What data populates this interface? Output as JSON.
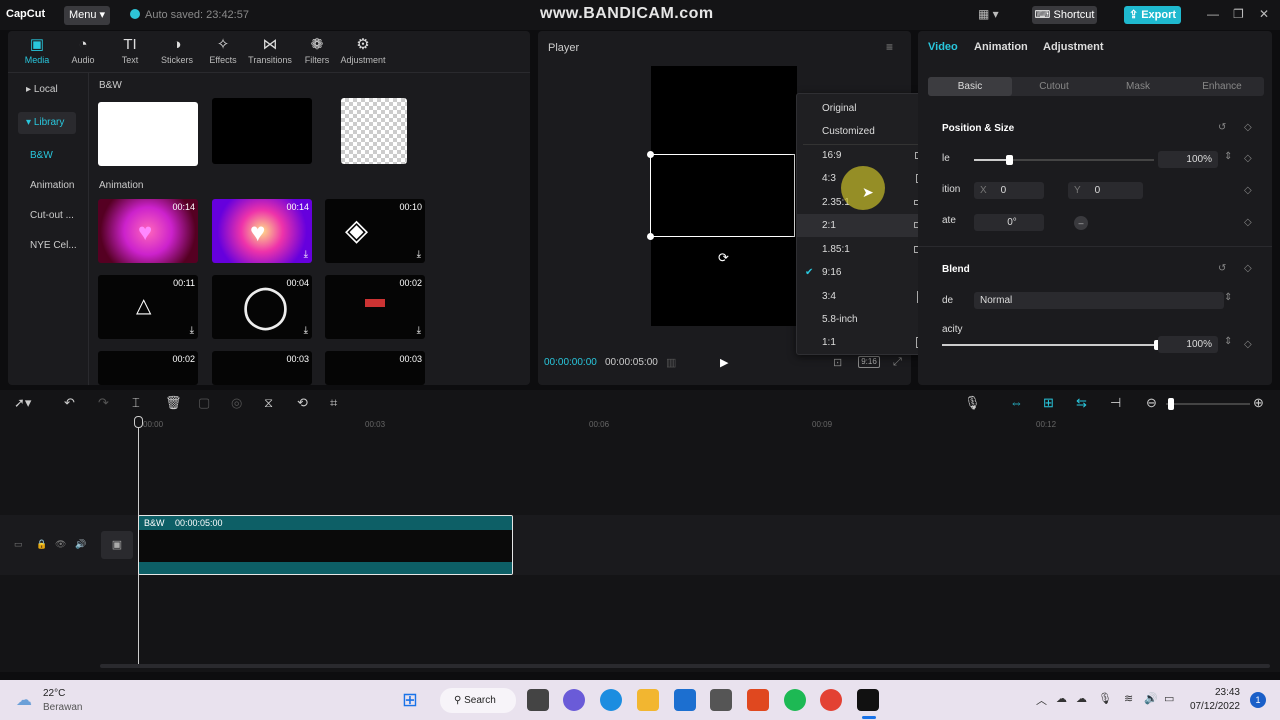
{
  "titlebar": {
    "app_name": "CapCut",
    "menu_label": "Menu",
    "autosave_text": "Auto saved: 23:42:57",
    "watermark": "www.BANDICAM.com",
    "shortcut_label": "Shortcut",
    "export_label": "Export"
  },
  "media": {
    "tools": [
      {
        "label": "Media",
        "icon": "media-icon"
      },
      {
        "label": "Audio",
        "icon": "audio-icon"
      },
      {
        "label": "Text",
        "icon": "text-icon"
      },
      {
        "label": "Stickers",
        "icon": "stickers-icon"
      },
      {
        "label": "Effects",
        "icon": "effects-icon"
      },
      {
        "label": "Transitions",
        "icon": "transitions-icon"
      },
      {
        "label": "Filters",
        "icon": "filters-icon"
      },
      {
        "label": "Adjustment",
        "icon": "adjustment-icon"
      }
    ],
    "side": {
      "local": "Local",
      "library": "Library"
    },
    "sub": [
      "B&W",
      "Animation",
      "Cut-out ...",
      "NYE Cel..."
    ],
    "section_bw": "B&W",
    "section_animation": "Animation",
    "durations": [
      "00:14",
      "00:14",
      "00:10",
      "00:11",
      "00:04",
      "00:02",
      "00:02",
      "00:03",
      "00:03"
    ]
  },
  "player": {
    "title": "Player",
    "time_current": "00:00:00:00",
    "time_total": "00:00:05:00",
    "ratio_badge": "9:16"
  },
  "ratio_menu": {
    "items": [
      "Original",
      "Customized",
      "16:9",
      "4:3",
      "2.35:1",
      "2:1",
      "1.85:1",
      "9:16",
      "3:4",
      "5.8-inch",
      "1:1"
    ],
    "selected": "9:16",
    "highlighted": "2:1"
  },
  "props": {
    "tabs": [
      "Video",
      "Animation",
      "Adjustment"
    ],
    "subtabs": [
      "Basic",
      "Cutout",
      "Mask",
      "Enhance"
    ],
    "position_size_title": "Position & Size",
    "scale_label": "le",
    "scale_value": "100%",
    "position_label": "ition",
    "x_label": "X",
    "x_value": "0",
    "y_label": "Y",
    "y_value": "0",
    "rotate_label": "ate",
    "rotate_value": "0°",
    "blend_title": "Blend",
    "mode_label": "de",
    "mode_value": "Normal",
    "opacity_label": "acity",
    "opacity_value": "100%"
  },
  "timeline": {
    "ruler": [
      "00:00",
      "00:03",
      "00:06",
      "00:09",
      "00:12"
    ],
    "clip_name": "B&W",
    "clip_duration": "00:00:05:00"
  },
  "taskbar": {
    "temp": "22°C",
    "weather": "Berawan",
    "search_label": "Search",
    "time": "23:43",
    "date": "07/12/2022",
    "notif_count": "1"
  }
}
